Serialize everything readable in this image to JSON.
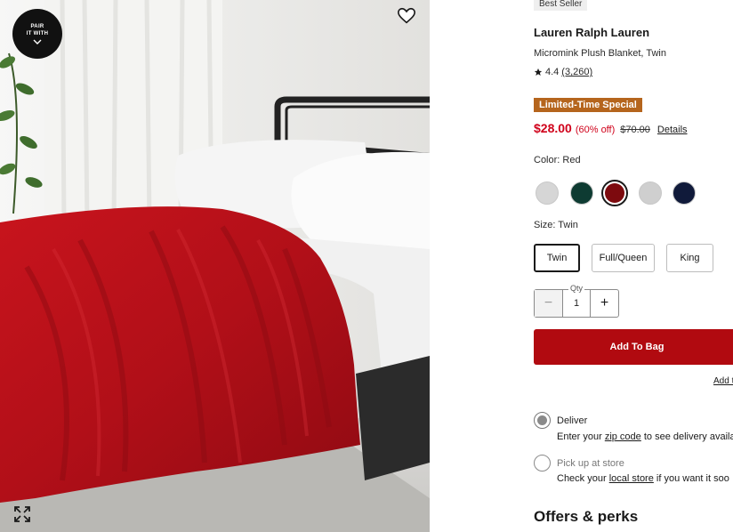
{
  "hero": {
    "pair_badge": {
      "line1": "PAIR",
      "line2": "IT WITH"
    }
  },
  "product": {
    "badge": "Best Seller",
    "brand": "Lauren Ralph Lauren",
    "name": "Micromink Plush Blanket, Twin",
    "rating": {
      "value": "4.4",
      "count": "(3,260)",
      "stars": 1
    },
    "promo": "Limited-Time Special",
    "price": {
      "current": "$28.00",
      "discount": "(60% off)",
      "original": "$70.00",
      "details_link": "Details"
    },
    "color": {
      "label": "Color: Red",
      "swatches": [
        {
          "name": "Light Gray",
          "color": "#d6d6d6",
          "selected": false
        },
        {
          "name": "Dark Green",
          "color": "#0e3b32",
          "selected": false
        },
        {
          "name": "Red",
          "color": "#7d0a0e",
          "selected": true
        },
        {
          "name": "Silver",
          "color": "#cfcfcf",
          "selected": false
        },
        {
          "name": "Navy",
          "color": "#101a3a",
          "selected": false
        }
      ]
    },
    "size": {
      "label": "Size: Twin",
      "options": [
        {
          "label": "Twin",
          "selected": true
        },
        {
          "label": "Full/Queen",
          "selected": false
        },
        {
          "label": "King",
          "selected": false
        }
      ]
    },
    "quantity": {
      "label": "Qty",
      "value": "1",
      "minus": "−",
      "plus": "+"
    },
    "add_to_bag": "Add To Bag",
    "add_link": "Add t",
    "fulfillment": {
      "deliver": {
        "title": "Deliver",
        "pre": "Enter your ",
        "link": "zip code",
        "post": " to see delivery availa",
        "selected": true
      },
      "pickup": {
        "title": "Pick up at store",
        "pre": "Check your ",
        "link": "local store",
        "post": " if you want it soo",
        "selected": false
      }
    },
    "offers_heading": "Offers & perks"
  },
  "colors": {
    "sale_red": "#d0021b",
    "bag_button": "#b10a10",
    "promo_bg": "#b5651d",
    "blanket": "#b5121b"
  },
  "icons": [
    "heart-icon",
    "expand-icon",
    "chevron-down-icon",
    "star-icon",
    "minus-icon",
    "plus-icon"
  ]
}
